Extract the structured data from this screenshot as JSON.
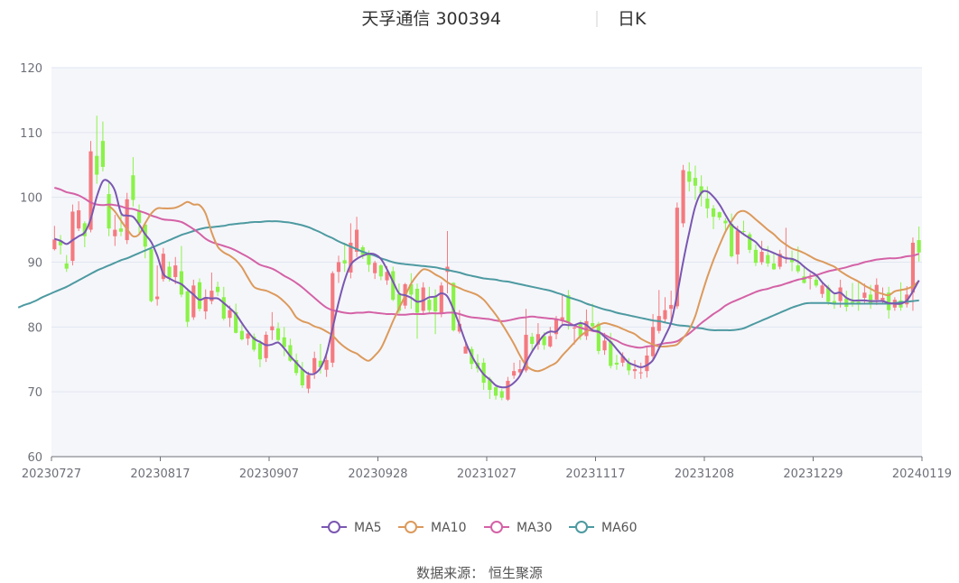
{
  "header": {
    "title": "天孚通信 300394",
    "period": "日K"
  },
  "source": "数据来源： 恒生聚源",
  "colors": {
    "up": "#f47a7f",
    "down": "#8af248",
    "ma5": "#7a57b1",
    "ma10": "#dc9a5c",
    "ma30": "#d462a6",
    "ma60": "#4d9aa1",
    "plot_bg": "#f5f6fa",
    "grid": "#e0e6f1",
    "axis": "#6e7079"
  },
  "chart_data": {
    "type": "candlestick",
    "ylim": [
      60,
      120
    ],
    "yticks": [
      60,
      70,
      80,
      90,
      100,
      110,
      120
    ],
    "xtick_labels": [
      "20230727",
      "20230817",
      "20230907",
      "20230928",
      "20231027",
      "20231117",
      "20231208",
      "20231229",
      "20240119"
    ],
    "legend": [
      {
        "key": "ma5",
        "label": "MA5"
      },
      {
        "key": "ma10",
        "label": "MA10"
      },
      {
        "key": "ma30",
        "label": "MA30"
      },
      {
        "key": "ma60",
        "label": "MA60"
      }
    ],
    "candles": [
      [
        92.0,
        93.5,
        91.8,
        95.6
      ],
      [
        93.2,
        92.6,
        91.2,
        94.2
      ],
      [
        89.8,
        89.0,
        88.5,
        91.1
      ],
      [
        90.2,
        97.8,
        89.5,
        98.9
      ],
      [
        95.2,
        98.0,
        94.8,
        99.4
      ],
      [
        96.0,
        94.0,
        92.3,
        96.3
      ],
      [
        95.0,
        107.1,
        94.6,
        108.7
      ],
      [
        106.4,
        103.5,
        102.1,
        112.6
      ],
      [
        108.7,
        104.7,
        104.0,
        111.7
      ],
      [
        100.5,
        95.2,
        94.0,
        102.6
      ],
      [
        94.0,
        95.0,
        92.5,
        97.3
      ],
      [
        95.2,
        94.7,
        94.0,
        97.5
      ],
      [
        93.4,
        99.7,
        92.8,
        100.7
      ],
      [
        103.4,
        99.6,
        98.6,
        106.2
      ],
      [
        98.0,
        96.0,
        94.4,
        98.9
      ],
      [
        95.8,
        92.4,
        90.6,
        96.2
      ],
      [
        92.0,
        84.0,
        83.8,
        92.5
      ],
      [
        84.3,
        84.7,
        83.3,
        89.5
      ],
      [
        87.4,
        91.3,
        87.0,
        92.2
      ],
      [
        89.3,
        87.6,
        87.0,
        90.1
      ],
      [
        87.7,
        89.5,
        86.6,
        90.8
      ],
      [
        88.6,
        85.0,
        84.6,
        92.5
      ],
      [
        85.5,
        80.8,
        80.0,
        86.0
      ],
      [
        81.5,
        86.4,
        81.1,
        87.3
      ],
      [
        86.9,
        82.8,
        82.4,
        87.5
      ],
      [
        82.4,
        84.6,
        81.2,
        85.8
      ],
      [
        84.0,
        85.6,
        83.5,
        88.4
      ],
      [
        86.2,
        85.4,
        84.8,
        87.0
      ],
      [
        84.6,
        81.3,
        81.0,
        86.2
      ],
      [
        81.4,
        82.6,
        80.0,
        83.3
      ],
      [
        82.3,
        79.1,
        79.0,
        83.6
      ],
      [
        79.4,
        78.1,
        77.9,
        80.6
      ],
      [
        78.2,
        79.0,
        77.2,
        79.5
      ],
      [
        78.5,
        76.5,
        76.2,
        79.0
      ],
      [
        77.5,
        75.0,
        73.8,
        78.0
      ],
      [
        75.2,
        78.8,
        74.6,
        79.3
      ],
      [
        79.5,
        80.1,
        78.0,
        82.3
      ],
      [
        79.8,
        78.0,
        77.6,
        80.7
      ],
      [
        78.4,
        76.9,
        75.5,
        80.0
      ],
      [
        77.2,
        74.8,
        74.6,
        78.2
      ],
      [
        74.9,
        72.9,
        72.5,
        75.9
      ],
      [
        73.5,
        71.0,
        70.6,
        74.6
      ],
      [
        70.5,
        72.6,
        69.8,
        73.1
      ],
      [
        72.9,
        75.2,
        72.0,
        76.2
      ],
      [
        74.8,
        73.8,
        72.8,
        77.4
      ],
      [
        73.4,
        74.9,
        72.3,
        75.9
      ],
      [
        74.5,
        88.3,
        73.8,
        88.6
      ],
      [
        88.5,
        90.0,
        86.8,
        91.0
      ],
      [
        90.3,
        89.8,
        88.5,
        93.0
      ],
      [
        88.4,
        93.0,
        87.5,
        96.0
      ],
      [
        91.6,
        95.0,
        90.8,
        97.0
      ],
      [
        92.3,
        91.1,
        90.5,
        92.6
      ],
      [
        91.2,
        89.6,
        88.5,
        91.8
      ],
      [
        88.3,
        89.9,
        87.4,
        90.2
      ],
      [
        89.5,
        87.8,
        87.2,
        89.7
      ],
      [
        87.2,
        88.5,
        86.5,
        89.4
      ],
      [
        88.6,
        84.2,
        84.0,
        89.3
      ],
      [
        85.1,
        82.5,
        82.1,
        86.7
      ],
      [
        83.3,
        86.6,
        82.8,
        86.8
      ],
      [
        86.6,
        85.0,
        82.8,
        88.3
      ],
      [
        85.9,
        82.2,
        78.2,
        86.7
      ],
      [
        82.5,
        86.1,
        81.9,
        86.9
      ],
      [
        84.2,
        82.6,
        82.0,
        86.2
      ],
      [
        84.7,
        82.4,
        78.9,
        85.8
      ],
      [
        82.1,
        86.4,
        81.5,
        86.9
      ],
      [
        88.5,
        89.3,
        85.2,
        94.8
      ],
      [
        86.8,
        79.5,
        79.3,
        86.9
      ],
      [
        79.3,
        80.5,
        79.0,
        82.6
      ],
      [
        75.9,
        77.0,
        76.0,
        77.5
      ],
      [
        76.6,
        74.3,
        73.5,
        77.0
      ],
      [
        74.5,
        73.6,
        73.0,
        75.8
      ],
      [
        74.5,
        71.4,
        70.3,
        75.2
      ],
      [
        72.0,
        70.3,
        68.9,
        72.3
      ],
      [
        70.7,
        69.4,
        68.8,
        71.0
      ],
      [
        70.1,
        69.1,
        68.7,
        70.5
      ],
      [
        68.8,
        71.7,
        68.6,
        72.3
      ],
      [
        72.5,
        73.2,
        72.0,
        74.5
      ],
      [
        73.0,
        73.5,
        72.7,
        74.9
      ],
      [
        73.3,
        78.8,
        73.0,
        82.8
      ],
      [
        78.5,
        77.4,
        76.3,
        79.1
      ],
      [
        77.3,
        78.9,
        76.5,
        80.6
      ],
      [
        78.6,
        77.2,
        76.5,
        79.2
      ],
      [
        77.0,
        78.6,
        76.8,
        80.0
      ],
      [
        78.9,
        81.3,
        78.1,
        81.7
      ],
      [
        80.9,
        81.5,
        80.4,
        84.9
      ],
      [
        84.9,
        80.6,
        79.6,
        85.7
      ],
      [
        79.9,
        79.9,
        77.3,
        80.2
      ],
      [
        80.5,
        78.6,
        78.0,
        81.0
      ],
      [
        78.6,
        80.9,
        78.0,
        82.7
      ],
      [
        80.6,
        80.1,
        79.8,
        83.6
      ],
      [
        80.5,
        76.3,
        75.8,
        80.8
      ],
      [
        76.4,
        77.9,
        75.7,
        79.1
      ],
      [
        77.8,
        74.0,
        73.6,
        79.1
      ],
      [
        74.5,
        74.2,
        73.4,
        75.7
      ],
      [
        74.5,
        75.5,
        73.9,
        76.1
      ],
      [
        74.5,
        73.3,
        72.6,
        75.2
      ],
      [
        73.2,
        73.5,
        72.0,
        74.9
      ],
      [
        73.0,
        73.0,
        72.0,
        74.5
      ],
      [
        73.2,
        75.6,
        72.2,
        77.0
      ],
      [
        75.5,
        80.0,
        74.7,
        82.0
      ],
      [
        79.4,
        81.7,
        79.0,
        85.7
      ],
      [
        81.2,
        82.6,
        80.6,
        84.6
      ],
      [
        82.8,
        83.4,
        80.9,
        85.6
      ],
      [
        83.2,
        98.4,
        82.8,
        99.2
      ],
      [
        96.0,
        104.2,
        95.4,
        105.0
      ],
      [
        104.0,
        102.4,
        100.9,
        105.4
      ],
      [
        103.0,
        101.8,
        99.6,
        104.9
      ],
      [
        101.7,
        100.6,
        98.6,
        103.4
      ],
      [
        99.8,
        98.3,
        96.8,
        101.7
      ],
      [
        98.3,
        97.0,
        95.1,
        98.8
      ],
      [
        97.7,
        96.9,
        96.5,
        97.8
      ],
      [
        96.4,
        96.0,
        94.6,
        96.8
      ],
      [
        95.9,
        90.9,
        90.7,
        97.5
      ],
      [
        91.2,
        94.9,
        89.7,
        95.6
      ],
      [
        94.8,
        94.7,
        94.1,
        96.4
      ],
      [
        94.3,
        91.9,
        91.4,
        94.6
      ],
      [
        91.9,
        89.9,
        89.4,
        92.7
      ],
      [
        90.0,
        91.6,
        89.6,
        93.3
      ],
      [
        91.1,
        89.8,
        89.3,
        92.5
      ],
      [
        89.8,
        88.9,
        88.8,
        91.5
      ],
      [
        89.3,
        91.3,
        88.9,
        91.9
      ],
      [
        90.6,
        90.8,
        89.8,
        95.3
      ],
      [
        90.6,
        90.0,
        88.6,
        91.8
      ],
      [
        89.5,
        88.6,
        88.3,
        92.4
      ],
      [
        87.8,
        86.8,
        86.7,
        89.5
      ],
      [
        87.5,
        87.6,
        85.8,
        88.3
      ],
      [
        87.3,
        86.4,
        86.1,
        87.9
      ],
      [
        85.1,
        86.4,
        84.5,
        86.7
      ],
      [
        86.1,
        83.9,
        83.4,
        86.5
      ],
      [
        84.0,
        83.5,
        82.8,
        85.1
      ],
      [
        84.0,
        86.1,
        83.0,
        87.3
      ],
      [
        84.4,
        83.1,
        82.4,
        85.6
      ],
      [
        83.9,
        83.5,
        83.1,
        86.8
      ],
      [
        83.9,
        83.7,
        82.5,
        86.9
      ],
      [
        84.5,
        85.3,
        83.5,
        86.7
      ],
      [
        85.0,
        83.6,
        82.8,
        86.5
      ],
      [
        84.2,
        86.5,
        83.4,
        87.5
      ],
      [
        84.1,
        84.5,
        83.6,
        86.1
      ],
      [
        85.3,
        82.6,
        81.3,
        86.2
      ],
      [
        83.0,
        84.2,
        82.5,
        84.6
      ],
      [
        84.1,
        83.0,
        82.5,
        86.9
      ],
      [
        83.5,
        85.0,
        83.0,
        86.3
      ],
      [
        85.3,
        93.0,
        82.5,
        93.8
      ],
      [
        93.4,
        91.5,
        90.1,
        95.5
      ]
    ],
    "ma5": [
      93.6,
      93.3,
      92.8,
      93.4,
      94.0,
      94.6,
      96.7,
      100.1,
      102.5,
      102.4,
      101.0,
      97.6,
      97.2,
      97.0,
      95.8,
      94.3,
      93.1,
      91.0,
      88.2,
      87.5,
      87.0,
      86.6,
      85.8,
      85.0,
      84.2,
      84.5,
      84.4,
      84.4,
      83.7,
      82.9,
      82.0,
      80.6,
      79.3,
      78.2,
      77.7,
      77.2,
      77.3,
      77.6,
      76.7,
      75.5,
      74.5,
      73.5,
      72.8,
      72.8,
      73.7,
      75.9,
      79.8,
      83.8,
      87.2,
      89.6,
      90.5,
      91.0,
      91.3,
      91.2,
      90.5,
      88.9,
      87.0,
      85.2,
      84.9,
      84.5,
      83.9,
      84.1,
      84.6,
      84.7,
      85.2,
      84.7,
      82.7,
      80.3,
      77.7,
      75.6,
      74.0,
      72.7,
      71.9,
      71.0,
      70.7,
      70.8,
      71.4,
      72.5,
      74.5,
      76.2,
      77.6,
      78.8,
      79.3,
      79.3,
      80.3,
      80.3,
      80.3,
      80.6,
      80.3,
      79.5,
      79.3,
      78.5,
      77.7,
      76.6,
      75.5,
      74.5,
      74.1,
      73.8,
      74.1,
      74.9,
      76.7,
      78.6,
      80.7,
      85.0,
      90.1,
      94.6,
      98.6,
      100.7,
      100.9,
      100.1,
      98.9,
      97.3,
      95.8,
      95.0,
      94.3,
      93.7,
      93.1,
      92.1,
      91.8,
      91.4,
      91.0,
      90.6,
      90.5,
      90.1,
      89.3,
      88.6,
      88.0,
      86.9,
      86.0,
      85.2,
      85.3,
      84.5,
      84.1,
      84.1,
      84.1,
      84.0,
      84.0,
      84.0,
      83.7,
      83.6,
      83.6,
      84.1,
      85.5,
      87.2
    ],
    "ma10": [
      98.7,
      97.8,
      96.4,
      95.1,
      94.0,
      94.3,
      96.0,
      97.5,
      98.3,
      98.3,
      98.3,
      98.4,
      98.8,
      99.3,
      98.9,
      98.8,
      97.5,
      94.6,
      92.4,
      91.5,
      91.0,
      90.3,
      89.2,
      87.6,
      86.2,
      85.8,
      85.6,
      85.2,
      84.7,
      83.9,
      82.9,
      81.5,
      80.9,
      80.6,
      80.1,
      79.8,
      79.3,
      78.7,
      77.7,
      76.9,
      76.3,
      75.9,
      75.2,
      74.8,
      75.6,
      76.7,
      78.7,
      80.9,
      82.9,
      84.8,
      86.7,
      88.0,
      88.9,
      88.7,
      88.1,
      87.6,
      86.9,
      86.4,
      86.0,
      85.6,
      85.3,
      84.9,
      84.2,
      83.1,
      81.9,
      80.5,
      79.0,
      77.4,
      75.6,
      74.1,
      73.4,
      73.2,
      73.5,
      74.0,
      74.5,
      75.6,
      76.6,
      77.6,
      78.6,
      79.3,
      79.8,
      80.3,
      80.6,
      80.4,
      80.1,
      79.7,
      79.3,
      78.9,
      78.2,
      77.7,
      77.3,
      77.0,
      77.0,
      77.1,
      77.3,
      78.3,
      79.6,
      81.7,
      84.8,
      87.7,
      90.3,
      92.6,
      94.7,
      96.3,
      97.6,
      97.9,
      97.4,
      96.6,
      95.8,
      95.0,
      94.3,
      93.4,
      92.7,
      92.1,
      91.8,
      91.4,
      90.9,
      90.4,
      90.1,
      89.7,
      89.3,
      88.6,
      88.0,
      87.5,
      87.0,
      86.4,
      85.9,
      85.4,
      85.1,
      84.9,
      85.5,
      85.7,
      85.9,
      86.3,
      87.1
    ],
    "ma30": [
      101.5,
      101.2,
      100.8,
      100.6,
      100.3,
      99.8,
      99.2,
      98.9,
      98.8,
      98.9,
      98.8,
      98.6,
      98.3,
      98.2,
      97.9,
      97.6,
      97.2,
      96.9,
      96.6,
      96.5,
      96.4,
      96.2,
      95.7,
      95.1,
      94.4,
      93.6,
      93.1,
      92.8,
      92.5,
      92.2,
      91.8,
      91.3,
      90.8,
      90.2,
      89.6,
      89.3,
      89.0,
      88.5,
      87.9,
      87.4,
      86.8,
      86.1,
      85.3,
      84.5,
      83.7,
      83.0,
      82.6,
      82.4,
      82.2,
      82.1,
      82.2,
      82.2,
      82.3,
      82.2,
      82.1,
      82.0,
      82.0,
      81.9,
      81.9,
      82.0,
      82.0,
      82.0,
      82.1,
      82.1,
      82.1,
      82.2,
      82.2,
      82.0,
      81.7,
      81.5,
      81.4,
      81.3,
      81.2,
      81.0,
      80.9,
      81.0,
      81.2,
      81.4,
      81.5,
      81.6,
      81.5,
      81.4,
      81.3,
      81.2,
      81.0,
      80.7,
      80.2,
      79.9,
      79.6,
      79.4,
      79.2,
      78.8,
      78.3,
      77.9,
      77.4,
      77.1,
      76.9,
      76.8,
      77.0,
      77.1,
      77.3,
      77.5,
      77.6,
      77.8,
      78.4,
      79.0,
      79.8,
      80.6,
      81.3,
      82.0,
      82.6,
      83.3,
      83.8,
      84.2,
      84.6,
      85.0,
      85.4,
      85.7,
      85.9,
      86.2,
      86.4,
      86.7,
      87.0,
      87.3,
      87.5,
      87.8,
      88.0,
      88.3,
      88.6,
      88.8,
      89.0,
      89.2,
      89.5,
      89.7,
      90.0,
      90.2,
      90.4,
      90.5,
      90.6,
      90.6,
      90.7,
      90.9,
      91.0,
      91.3
    ],
    "ma60": [
      83.0,
      83.4,
      83.7,
      84.1,
      84.6,
      85.0,
      85.4,
      85.8,
      86.2,
      86.7,
      87.2,
      87.7,
      88.2,
      88.7,
      89.1,
      89.5,
      89.9,
      90.3,
      90.6,
      91.0,
      91.4,
      91.8,
      92.2,
      92.6,
      93.0,
      93.4,
      93.8,
      94.2,
      94.5,
      94.8,
      95.1,
      95.3,
      95.4,
      95.5,
      95.6,
      95.8,
      95.9,
      96.0,
      96.1,
      96.2,
      96.2,
      96.3,
      96.3,
      96.3,
      96.2,
      96.1,
      95.9,
      95.7,
      95.4,
      95.0,
      94.6,
      94.1,
      93.7,
      93.2,
      92.8,
      92.4,
      92.0,
      91.6,
      91.3,
      91.0,
      90.6,
      90.3,
      90.0,
      89.8,
      89.7,
      89.6,
      89.5,
      89.4,
      89.3,
      89.2,
      89.0,
      88.8,
      88.6,
      88.4,
      88.1,
      87.9,
      87.7,
      87.5,
      87.4,
      87.3,
      87.1,
      87.0,
      86.8,
      86.6,
      86.4,
      86.2,
      86.0,
      85.8,
      85.6,
      85.3,
      85.0,
      84.6,
      84.3,
      84.0,
      83.6,
      83.3,
      83.0,
      82.7,
      82.5,
      82.2,
      82.0,
      81.8,
      81.6,
      81.4,
      81.2,
      81.0,
      80.9,
      80.7,
      80.5,
      80.3,
      80.2,
      80.1,
      79.9,
      79.8,
      79.6,
      79.5,
      79.5,
      79.5,
      79.5,
      79.6,
      79.8,
      80.2,
      80.6,
      81.0,
      81.4,
      81.8,
      82.2,
      82.6,
      83.0,
      83.3,
      83.6,
      83.7,
      83.7,
      83.7,
      83.7,
      83.6,
      83.6,
      83.6,
      83.6,
      83.6,
      83.6,
      83.6,
      83.6,
      83.6,
      83.6,
      83.7,
      83.8,
      83.9,
      84.0,
      84.1
    ]
  }
}
